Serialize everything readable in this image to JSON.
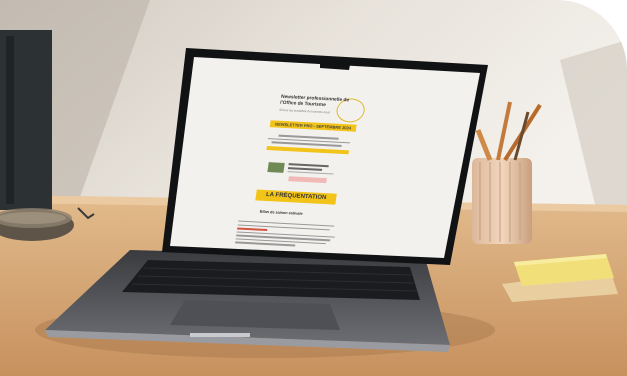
{
  "newsletter": {
    "title_line1": "Newsletter professionnelle de",
    "title_line2": "l'Office de Tourisme",
    "subtitle": "Suivez les actualités du tourisme local",
    "banner": "NEWSLETTER PRO - SEPTEMBRE 2024",
    "section_heading": "LA FRÉQUENTATION",
    "section_subheading": "Bilan de saison estivale"
  },
  "colors": {
    "accent_yellow": "#f2c318",
    "accent_pink": "#f1b9b6",
    "desk": "#d8ab7a"
  }
}
